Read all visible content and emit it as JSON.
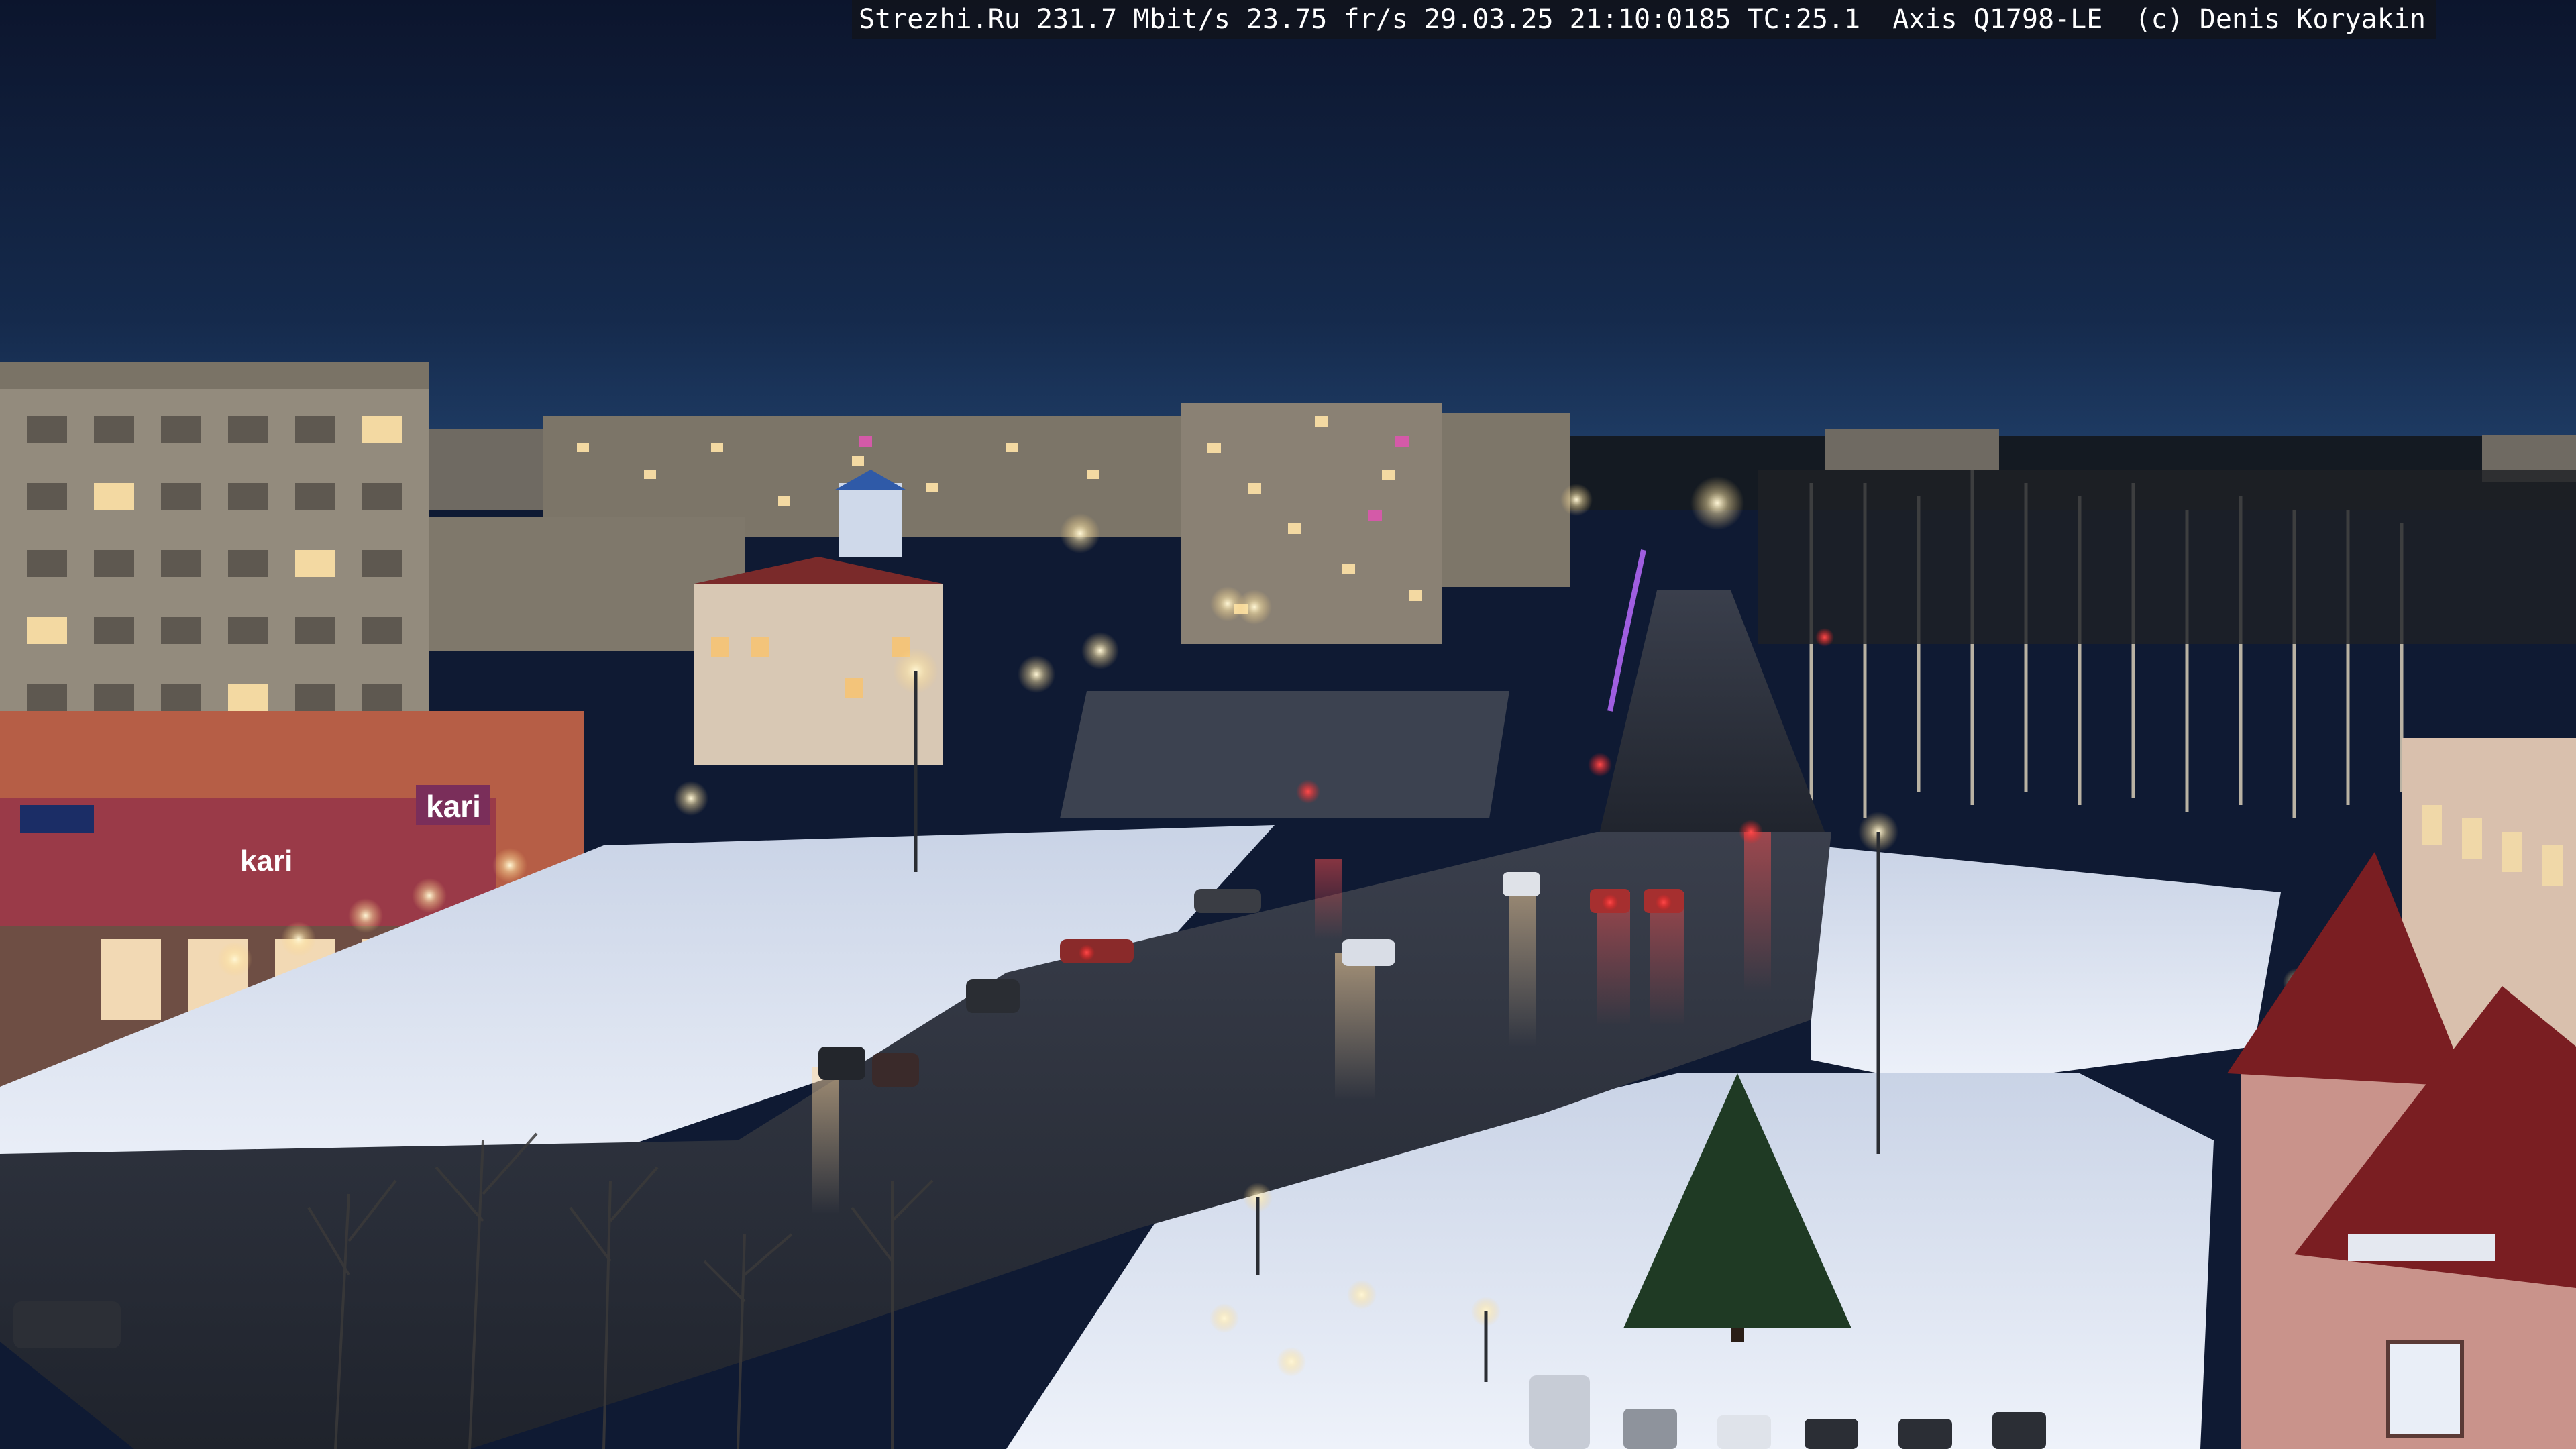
{
  "overlay": {
    "osd": "Strezhi.Ru 231.7 Mbit/s 23.75 fr/s 29.03.25 21:10:0185 TC:25.1  Axis Q1798-LE  (c) Denis Koryakin"
  },
  "signage": {
    "store_sign": "kari",
    "store_sign_2": "kari"
  },
  "colors": {
    "sky_top": "#0d1630",
    "sky_horizon": "#1c3a63",
    "snow": "#dfe7f4",
    "road": "#2a2f3a",
    "streetlight": "#fff6d8",
    "building": "#8e8677",
    "storefront": "#9a3a48",
    "roof_red": "#7a1e22"
  }
}
